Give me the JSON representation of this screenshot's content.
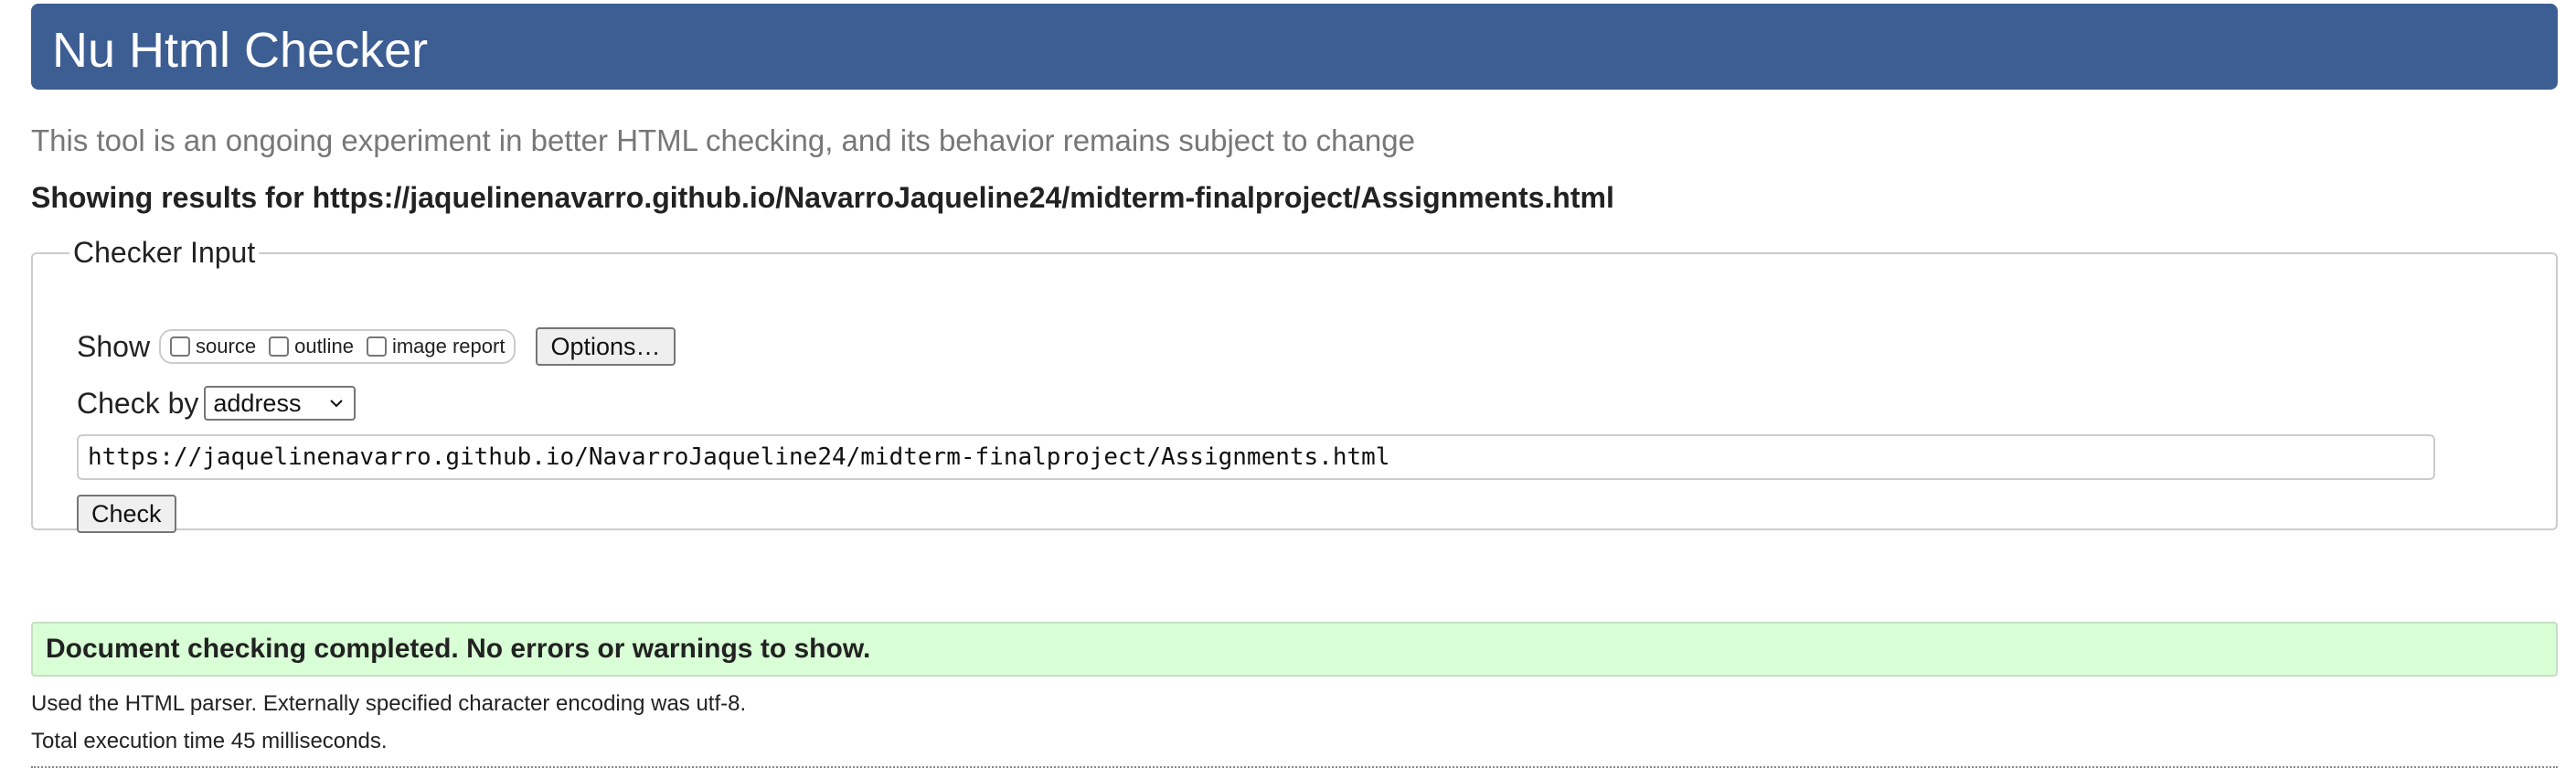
{
  "header": {
    "title": "Nu Html Checker"
  },
  "subtitle": "This tool is an ongoing experiment in better HTML checking, and its behavior remains subject to change",
  "results_for": "Showing results for https://jaquelinenavarro.github.io/NavarroJaqueline24/midterm-finalproject/Assignments.html",
  "checker_input": {
    "legend": "Checker Input",
    "show_label": "Show",
    "show_options": [
      {
        "label": "source",
        "checked": false
      },
      {
        "label": "outline",
        "checked": false
      },
      {
        "label": "image report",
        "checked": false
      }
    ],
    "options_button": "Options…",
    "check_by_label": "Check by",
    "check_by_value": "address",
    "url_value": "https://jaquelinenavarro.github.io/NavarroJaqueline24/midterm-finalproject/Assignments.html",
    "check_button": "Check"
  },
  "result": {
    "message": "Document checking completed. No errors or warnings to show.",
    "details": [
      "Used the HTML parser. Externally specified character encoding was utf-8.",
      "Total execution time 45 milliseconds."
    ]
  },
  "colors": {
    "header_bg": "#3d5e93",
    "success_bg": "#d8ffd5",
    "subtitle_text": "#777777"
  },
  "icons": {
    "select_chevron": "chevron-down-icon"
  }
}
